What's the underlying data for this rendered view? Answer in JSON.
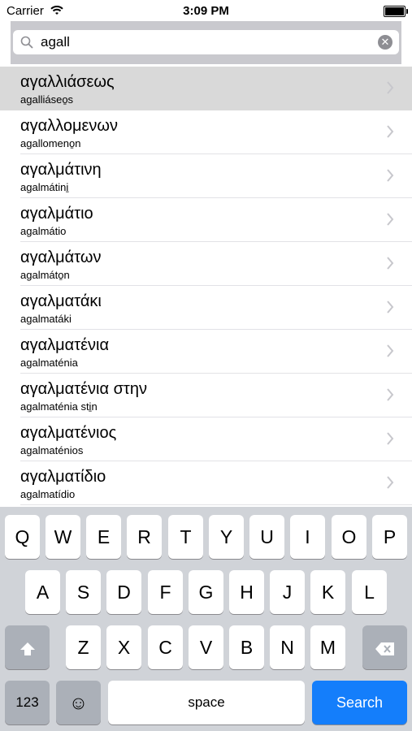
{
  "status": {
    "carrier": "Carrier",
    "time": "3:09 PM"
  },
  "search": {
    "query": "agall",
    "clear": "✕"
  },
  "results": [
    {
      "greek": "αγαλλιάσεως",
      "latin": "agalliáseo̱s",
      "selected": true
    },
    {
      "greek": "αγαλλομενων",
      "latin": "agallomeno̱n"
    },
    {
      "greek": "αγαλμάτινη",
      "latin": "agalmátini̱"
    },
    {
      "greek": "αγαλμάτιο",
      "latin": "agalmátio"
    },
    {
      "greek": "αγαλμάτων",
      "latin": "agalmáto̱n"
    },
    {
      "greek": "αγαλματάκι",
      "latin": "agalmatáki"
    },
    {
      "greek": "αγαλματένια",
      "latin": "agalmaténia"
    },
    {
      "greek": "αγαλματένια στην",
      "latin": "agalmaténia sti̱n"
    },
    {
      "greek": "αγαλματένιος",
      "latin": "agalmaténios"
    },
    {
      "greek": "αγαλματίδιο",
      "latin": "agalmatídio"
    }
  ],
  "keyboard": {
    "row1": [
      "Q",
      "W",
      "E",
      "R",
      "T",
      "Y",
      "U",
      "I",
      "O",
      "P"
    ],
    "row2": [
      "A",
      "S",
      "D",
      "F",
      "G",
      "H",
      "J",
      "K",
      "L"
    ],
    "row3": [
      "Z",
      "X",
      "C",
      "V",
      "B",
      "N",
      "M"
    ],
    "numbers_label": "123",
    "emoji_label": "☺",
    "space_label": "space",
    "search_label": "Search"
  },
  "icons": {
    "shift": "shift-icon",
    "delete": "delete-icon",
    "wifi": "wifi-icon",
    "battery": "battery-icon",
    "magnifier": "search-icon",
    "chevron": "chevron-right-icon"
  }
}
